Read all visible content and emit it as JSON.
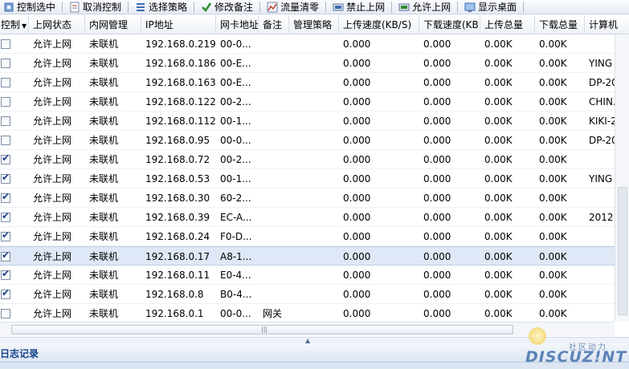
{
  "toolbar": {
    "buttons": [
      {
        "label": "控制选中",
        "icon": "control-icon"
      },
      {
        "label": "取消控制",
        "icon": "cancel-control-icon"
      },
      {
        "label": "选择策略",
        "icon": "policy-list-icon"
      },
      {
        "label": "修改备注",
        "icon": "check-icon"
      },
      {
        "label": "流量清零",
        "icon": "traffic-chart-icon"
      },
      {
        "label": "禁止上网",
        "icon": "block-internet-icon"
      },
      {
        "label": "允许上网",
        "icon": "allow-internet-icon"
      },
      {
        "label": "显示桌面",
        "icon": "show-desktop-icon"
      }
    ]
  },
  "grid": {
    "columns": [
      "控制",
      "上网状态",
      "内网管理",
      "IP地址",
      "网卡地址",
      "备注",
      "管理策略",
      "上传速度(KB/S)",
      "下载速度(KB",
      "上传总量",
      "下载总量",
      "计算机"
    ],
    "rows": [
      {
        "checked": false,
        "status": "允许上网",
        "lan": "未联机",
        "ip": "192.168.0.219",
        "mac": "00-0...",
        "note": "",
        "policy": "",
        "up": "0.000",
        "down": "0.000",
        "up_total": "0.00K",
        "down_total": "0.00K",
        "host": ""
      },
      {
        "checked": false,
        "status": "允许上网",
        "lan": "未联机",
        "ip": "192.168.0.186",
        "mac": "00-E...",
        "note": "",
        "policy": "",
        "up": "0.000",
        "down": "0.000",
        "up_total": "0.00K",
        "down_total": "0.00K",
        "host": "YING"
      },
      {
        "checked": false,
        "status": "允许上网",
        "lan": "未联机",
        "ip": "192.168.0.163",
        "mac": "00-E...",
        "note": "",
        "policy": "",
        "up": "0.000",
        "down": "0.000",
        "up_total": "0.00K",
        "down_total": "0.00K",
        "host": "DP-20"
      },
      {
        "checked": false,
        "status": "允许上网",
        "lan": "未联机",
        "ip": "192.168.0.122",
        "mac": "00-2...",
        "note": "",
        "policy": "",
        "up": "0.000",
        "down": "0.000",
        "up_total": "0.00K",
        "down_total": "0.00K",
        "host": "CHIN."
      },
      {
        "checked": false,
        "status": "允许上网",
        "lan": "未联机",
        "ip": "192.168.0.112",
        "mac": "00-1...",
        "note": "",
        "policy": "",
        "up": "0.000",
        "down": "0.000",
        "up_total": "0.00K",
        "down_total": "0.00K",
        "host": "KIKI-2"
      },
      {
        "checked": false,
        "status": "允许上网",
        "lan": "未联机",
        "ip": "192.168.0.95",
        "mac": "00-0...",
        "note": "",
        "policy": "",
        "up": "0.000",
        "down": "0.000",
        "up_total": "0.00K",
        "down_total": "0.00K",
        "host": "DP-20"
      },
      {
        "checked": true,
        "status": "允许上网",
        "lan": "未联机",
        "ip": "192.168.0.72",
        "mac": "00-2...",
        "note": "",
        "policy": "",
        "up": "0.000",
        "down": "0.000",
        "up_total": "0.00K",
        "down_total": "0.00K",
        "host": ""
      },
      {
        "checked": true,
        "status": "允许上网",
        "lan": "未联机",
        "ip": "192.168.0.53",
        "mac": "00-1...",
        "note": "",
        "policy": "",
        "up": "0.000",
        "down": "0.000",
        "up_total": "0.00K",
        "down_total": "0.00K",
        "host": "YING"
      },
      {
        "checked": true,
        "status": "允许上网",
        "lan": "未联机",
        "ip": "192.168.0.30",
        "mac": "60-2...",
        "note": "",
        "policy": "",
        "up": "0.000",
        "down": "0.000",
        "up_total": "0.00K",
        "down_total": "0.00K",
        "host": ""
      },
      {
        "checked": true,
        "status": "允许上网",
        "lan": "未联机",
        "ip": "192.168.0.39",
        "mac": "EC-A...",
        "note": "",
        "policy": "",
        "up": "0.000",
        "down": "0.000",
        "up_total": "0.00K",
        "down_total": "0.00K",
        "host": "2012"
      },
      {
        "checked": true,
        "status": "允许上网",
        "lan": "未联机",
        "ip": "192.168.0.24",
        "mac": "F0-D...",
        "note": "",
        "policy": "",
        "up": "0.000",
        "down": "0.000",
        "up_total": "0.00K",
        "down_total": "0.00K",
        "host": ""
      },
      {
        "checked": true,
        "status": "允许上网",
        "lan": "未联机",
        "ip": "192.168.0.17",
        "mac": "A8-1...",
        "note": "",
        "policy": "",
        "up": "0.000",
        "down": "0.000",
        "up_total": "0.00K",
        "down_total": "0.00K",
        "host": "",
        "selected": true
      },
      {
        "checked": true,
        "status": "允许上网",
        "lan": "未联机",
        "ip": "192.168.0.11",
        "mac": "E0-4...",
        "note": "",
        "policy": "",
        "up": "0.000",
        "down": "0.000",
        "up_total": "0.00K",
        "down_total": "0.00K",
        "host": ""
      },
      {
        "checked": true,
        "status": "允许上网",
        "lan": "未联机",
        "ip": "192.168.0.8",
        "mac": "B0-4...",
        "note": "",
        "policy": "",
        "up": "0.000",
        "down": "0.000",
        "up_total": "0.00K",
        "down_total": "0.00K",
        "host": ""
      },
      {
        "checked": false,
        "status": "允许上网",
        "lan": "未联机",
        "ip": "192.168.0.1",
        "mac": "00-0...",
        "note": "网关",
        "policy": "",
        "up": "0.000",
        "down": "0.000",
        "up_total": "0.00K",
        "down_total": "0.00K",
        "host": ""
      }
    ]
  },
  "log_panel": {
    "title": "日志记录"
  },
  "watermark": {
    "small": "社区动力",
    "big": "DISCUZ!NT"
  }
}
